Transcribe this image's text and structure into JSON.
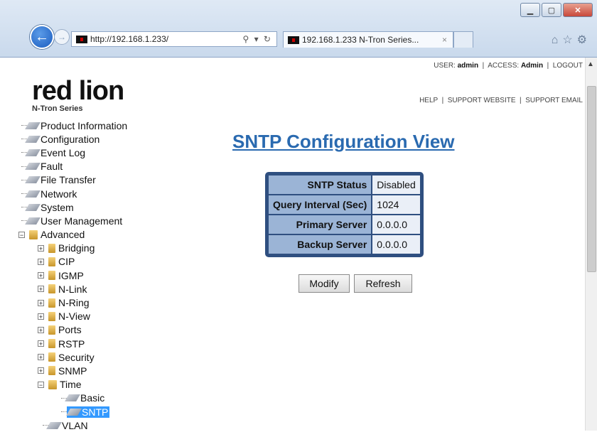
{
  "browser": {
    "url": "http://192.168.1.233/",
    "tab_title": "192.168.1.233 N-Tron Series...",
    "tab_close": "×"
  },
  "header": {
    "logo_main": "red lion",
    "logo_sub": "N-Tron Series",
    "user_label": "USER:",
    "user_value": "admin",
    "access_label": "ACCESS:",
    "access_value": "Admin",
    "logout": "LOGOUT",
    "help": "HELP",
    "support_website": "SUPPORT WEBSITE",
    "support_email": "SUPPORT EMAIL"
  },
  "tree": {
    "product_information": "Product Information",
    "configuration": "Configuration",
    "event_log": "Event Log",
    "fault": "Fault",
    "file_transfer": "File Transfer",
    "network": "Network",
    "system": "System",
    "user_management": "User Management",
    "advanced": "Advanced",
    "bridging": "Bridging",
    "cip": "CIP",
    "igmp": "IGMP",
    "nlink": "N-Link",
    "nring": "N-Ring",
    "nview": "N-View",
    "ports": "Ports",
    "rstp": "RSTP",
    "security": "Security",
    "snmp": "SNMP",
    "time": "Time",
    "basic": "Basic",
    "sntp": "SNTP",
    "vlan": "VLAN"
  },
  "main": {
    "title": "SNTP Configuration View",
    "rows": [
      {
        "label": "SNTP Status",
        "value": "Disabled"
      },
      {
        "label": "Query Interval (Sec)",
        "value": "1024"
      },
      {
        "label": "Primary Server",
        "value": "0.0.0.0"
      },
      {
        "label": "Backup Server",
        "value": "0.0.0.0"
      }
    ],
    "modify_label": "Modify",
    "refresh_label": "Refresh"
  }
}
